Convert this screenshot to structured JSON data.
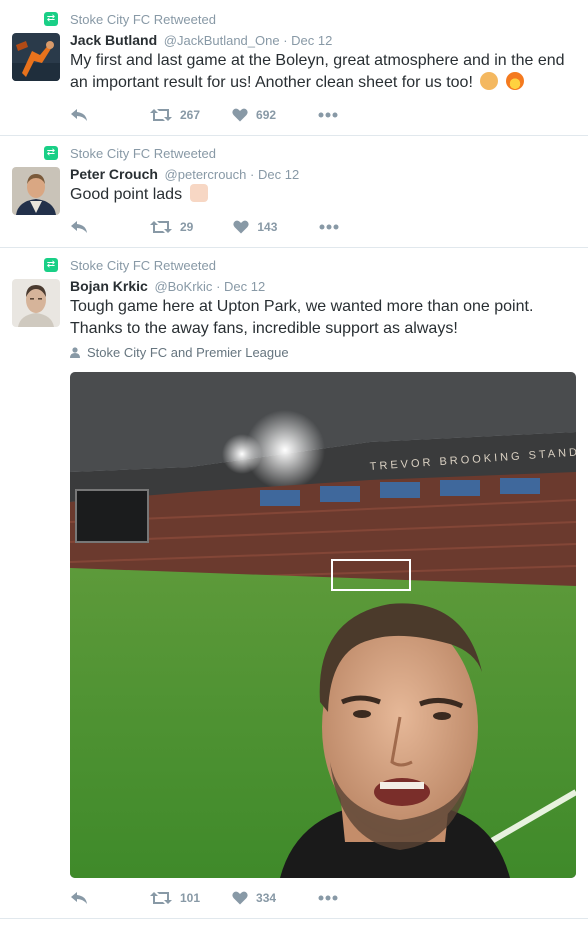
{
  "tweets": [
    {
      "retweet_label": "Stoke City FC Retweeted",
      "name": "Jack Butland",
      "handle": "@JackButland_One",
      "date": "Dec 12",
      "text": "My first and last game at the Boleyn, great atmosphere and in the end an important result for us! Another clean sheet for us too!",
      "retweets": "267",
      "likes": "692"
    },
    {
      "retweet_label": "Stoke City FC Retweeted",
      "name": "Peter Crouch",
      "handle": "@petercrouch",
      "date": "Dec 12",
      "text": "Good point lads",
      "retweets": "29",
      "likes": "143"
    },
    {
      "retweet_label": "Stoke City FC Retweeted",
      "name": "Bojan Krkic",
      "handle": "@BoKrkic",
      "date": "Dec 12",
      "text": "Tough game here at Upton Park, we wanted more than one point. Thanks to the away fans, incredible support as always!",
      "tagged": "Stoke City FC and Premier League",
      "retweets": "101",
      "likes": "334"
    }
  ],
  "stadium_sign": "TREVOR BROOKING STAND",
  "colors": {
    "retweet_green": "#19cf86",
    "meta_gray": "#8899a6",
    "text": "#292f33"
  }
}
